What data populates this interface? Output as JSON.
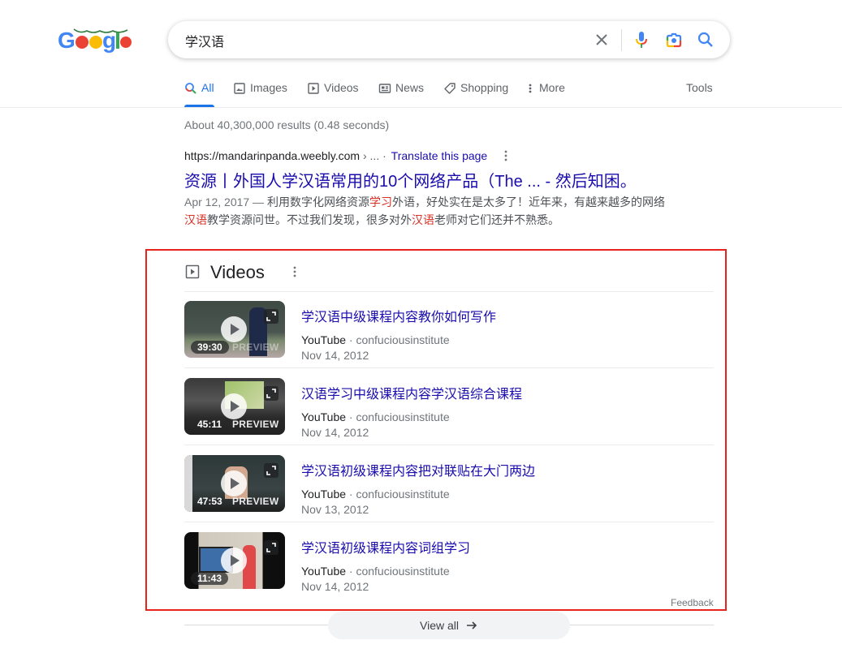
{
  "header": {
    "logo_alt": "Google",
    "search_query": "学汉语",
    "icons": [
      "clear-icon",
      "microphone-icon",
      "google-lens-icon",
      "search-icon"
    ]
  },
  "tabs": [
    {
      "label": "All",
      "icon": "search-icon",
      "active": true
    },
    {
      "label": "Images",
      "icon": "image-icon"
    },
    {
      "label": "Videos",
      "icon": "play-icon"
    },
    {
      "label": "News",
      "icon": "news-icon"
    },
    {
      "label": "Shopping",
      "icon": "tag-icon"
    },
    {
      "label": "More",
      "icon": "more-vert-icon"
    }
  ],
  "tools_label": "Tools",
  "stats": "About 40,300,000 results (0.48 seconds)",
  "result": {
    "url": "https://mandarinpanda.weebly.com",
    "url_suffix": " › ...",
    "dot": " · ",
    "translate": "Translate this page",
    "title": "资源丨外国人学汉语常用的10个网络产品（The ... - 然后知困。",
    "snippet": {
      "date": "Apr 12, 2017 — ",
      "p1": "利用数字化网络资源",
      "h1": "学习",
      "p2": "外语，好处实在是太多了！近年来，有越来越多的网络",
      "h2": "汉语",
      "p3": "教学资源问世。不过我们发现，很多对外",
      "h3": "汉语",
      "p4": "老师对它们还并不熟悉。"
    }
  },
  "videos": {
    "heading": "Videos",
    "items": [
      {
        "title": "学汉语中级课程内容教你如何写作",
        "source": "YouTube",
        "channel": "confuciousinstitute",
        "date": "Nov 14, 2012",
        "duration": "39:30",
        "preview": "PREVIEW"
      },
      {
        "title": "汉语学习中级课程内容学汉语综合课程",
        "source": "YouTube",
        "channel": "confuciousinstitute",
        "date": "Nov 14, 2012",
        "duration": "45:11",
        "preview": "PREVIEW"
      },
      {
        "title": "学汉语初级课程内容把对联贴在大门两边",
        "source": "YouTube",
        "channel": "confuciousinstitute",
        "date": "Nov 13, 2012",
        "duration": "47:53",
        "preview": "PREVIEW"
      },
      {
        "title": "学汉语初级课程内容词组学习",
        "source": "YouTube",
        "channel": "confuciousinstitute",
        "date": "Nov 14, 2012",
        "duration": "11:43",
        "preview": ""
      }
    ],
    "meta_sep": " · ",
    "feedback": "Feedback",
    "view_all": "View all"
  }
}
